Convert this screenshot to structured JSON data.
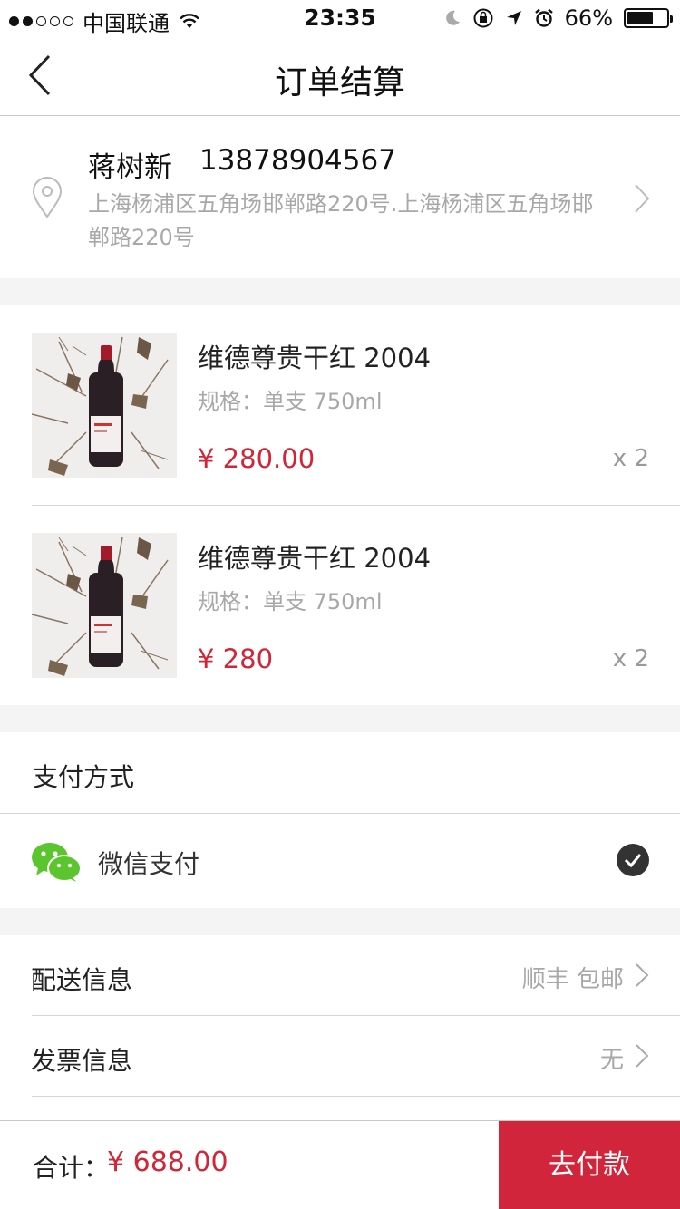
{
  "status_bar": {
    "carrier": "中国联通",
    "time": "23:35",
    "battery_percent": "66%",
    "battery_level": 0.66
  },
  "nav": {
    "title": "订单结算"
  },
  "address": {
    "name": "蒋树新",
    "phone": "13878904567",
    "detail": "上海杨浦区五角场邯郸路220号.上海杨浦区五角场邯郸路220号"
  },
  "products": [
    {
      "name": "维德尊贵干红 2004",
      "spec": "规格：单支 750ml",
      "price": "¥ 280.00",
      "qty": "x 2"
    },
    {
      "name": "维德尊贵干红 2004",
      "spec": "规格：单支 750ml",
      "price": "¥ 280",
      "qty": "x 2"
    }
  ],
  "payment": {
    "title": "支付方式",
    "method": "微信支付"
  },
  "delivery": {
    "label": "配送信息",
    "value": "顺丰 包邮"
  },
  "invoice": {
    "label": "发票信息",
    "value": "无"
  },
  "footer": {
    "total_label": "合计：",
    "total_value": "¥ 688.00",
    "pay_button": "去付款"
  },
  "colors": {
    "accent": "#d0253a",
    "price": "#d12638",
    "wechat_green": "#5ac52c"
  }
}
